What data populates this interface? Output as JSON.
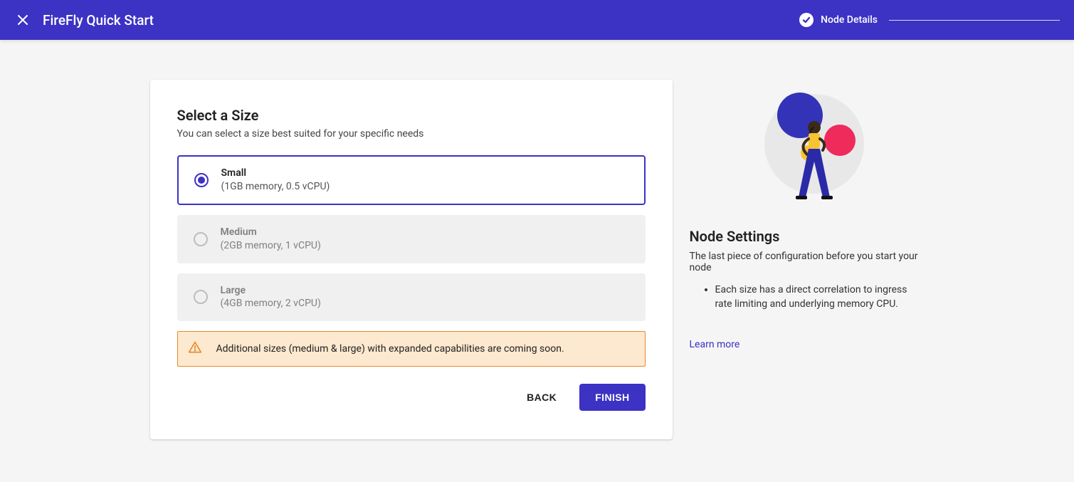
{
  "header": {
    "title": "FireFly Quick Start",
    "step_label": "Node Details"
  },
  "card": {
    "title": "Select a Size",
    "subtitle": "You can select a size best suited for your specific needs",
    "options": [
      {
        "name": "Small",
        "detail": "(1GB memory, 0.5 vCPU)",
        "selected": true,
        "enabled": true
      },
      {
        "name": "Medium",
        "detail": "(2GB memory, 1 vCPU)",
        "selected": false,
        "enabled": false
      },
      {
        "name": "Large",
        "detail": "(4GB memory, 2 vCPU)",
        "selected": false,
        "enabled": false
      }
    ],
    "alert_text": "Additional sizes (medium & large) with expanded capabilities are coming soon.",
    "back_label": "BACK",
    "finish_label": "FINISH"
  },
  "side": {
    "title": "Node Settings",
    "subtitle": "The last piece of configuration before you start your node",
    "bullets": [
      "Each size has a direct correlation to ingress rate limiting and underlying memory CPU."
    ],
    "learn_more": "Learn more"
  }
}
